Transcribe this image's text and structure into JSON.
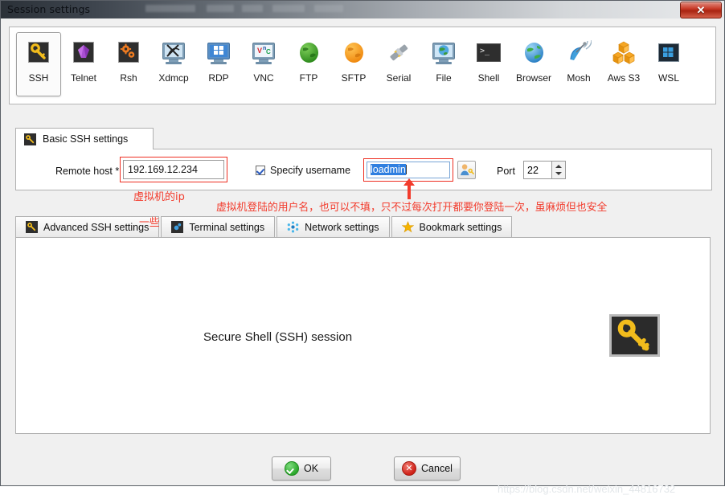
{
  "window": {
    "title": "Session settings",
    "close_label": "✕"
  },
  "toolbar": {
    "items": [
      {
        "label": "SSH",
        "icon": "key-icon",
        "selected": true
      },
      {
        "label": "Telnet",
        "icon": "gem-icon",
        "selected": false
      },
      {
        "label": "Rsh",
        "icon": "gears-icon",
        "selected": false
      },
      {
        "label": "Xdmcp",
        "icon": "monitor-x-icon",
        "selected": false
      },
      {
        "label": "RDP",
        "icon": "monitor-windows-icon",
        "selected": false
      },
      {
        "label": "VNC",
        "icon": "monitor-vnc-icon",
        "selected": false
      },
      {
        "label": "FTP",
        "icon": "green-globe-icon",
        "selected": false
      },
      {
        "label": "SFTP",
        "icon": "orange-globe-icon",
        "selected": false
      },
      {
        "label": "Serial",
        "icon": "plug-icon",
        "selected": false
      },
      {
        "label": "File",
        "icon": "monitor-globe-icon",
        "selected": false
      },
      {
        "label": "Shell",
        "icon": "terminal-icon",
        "selected": false
      },
      {
        "label": "Browser",
        "icon": "earth-icon",
        "selected": false
      },
      {
        "label": "Mosh",
        "icon": "satellite-dish-icon",
        "selected": false
      },
      {
        "label": "Aws S3",
        "icon": "cubes-icon",
        "selected": false
      },
      {
        "label": "WSL",
        "icon": "windows-logo-icon",
        "selected": false
      }
    ]
  },
  "basic_tab": {
    "label": "Basic SSH settings",
    "remote_host_label": "Remote host *",
    "remote_host_value": "192.169.12.234",
    "specify_username_label": "Specify username",
    "specify_username_checked": true,
    "username_value": "loadmin",
    "port_label": "Port",
    "port_value": "22"
  },
  "annotations": {
    "ip_note": "虚拟机的ip",
    "user_note_line1": "虚拟机登陆的用户名，也可以不填，只不过每次打开都要你登陆一次，虽麻烦但也安全",
    "user_note_line2": "一些",
    "color": "#f23b2c"
  },
  "sub_tabs": [
    {
      "label": "Advanced SSH settings",
      "icon": "key-icon"
    },
    {
      "label": "Terminal settings",
      "icon": "terminal-blue-icon"
    },
    {
      "label": "Network settings",
      "icon": "network-nodes-icon"
    },
    {
      "label": "Bookmark settings",
      "icon": "star-icon"
    }
  ],
  "main_panel": {
    "session_text": "Secure Shell (SSH) session",
    "big_icon": "key-icon"
  },
  "buttons": {
    "ok": "OK",
    "cancel": "Cancel",
    "cancel_glyph": "✕"
  },
  "watermark": "https://blog.csdn.net/weixin_44816732"
}
